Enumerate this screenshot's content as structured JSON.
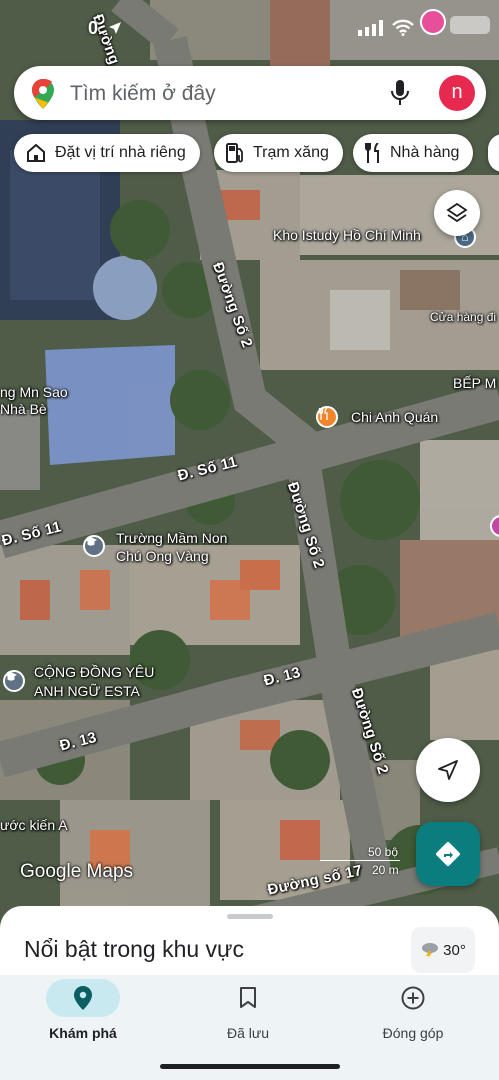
{
  "status_bar": {
    "time": "0"
  },
  "search": {
    "placeholder": "Tìm kiếm ở đây",
    "avatar_letter": "n"
  },
  "chips": [
    {
      "label": "Đặt vị trí nhà riêng",
      "icon": "home-icon"
    },
    {
      "label": "Trạm xăng",
      "icon": "gas-station-icon"
    },
    {
      "label": "Nhà hàng",
      "icon": "restaurant-icon"
    }
  ],
  "map": {
    "roads": {
      "duong_so_2_a": "Đường Số 2",
      "duong_so_2_b": "Đường Số 2",
      "duong_so_2_c": "Đường Số 2",
      "duong_top": "Đường",
      "d_so_11_a": "Đ. Số 11",
      "d_so_11_b": "Đ. Số 11",
      "d_13_a": "Đ. 13",
      "d_13_b": "Đ. 13",
      "duong_so_17": "Đường số 17"
    },
    "pois": {
      "kho_istudy": "Kho Istudy Hồ Chí Minh",
      "cua_hang": "Cửa hàng đi",
      "bep": "BẾP M",
      "mn_sao_1": "ng Mn Sao",
      "mn_sao_2": "Nhà Bè",
      "chi_anh_quan": "Chi Anh Quán",
      "truong_mam_non_1": "Trường Mầm Non",
      "truong_mam_non_2": "Chú Ong Vàng",
      "cong_dong_1": "CỘNG ĐỒNG YÊU",
      "cong_dong_2": "ANH NGỮ ESTA",
      "nuoc_kien": "ước kiến A"
    },
    "scale": {
      "top": "50 bộ",
      "bottom": "20 m"
    },
    "attribution": "Google Maps"
  },
  "sheet": {
    "title": "Nổi bật trong khu vực",
    "temperature": "30°"
  },
  "bottom_nav": [
    {
      "label": "Khám phá",
      "icon": "explore-pin-icon",
      "active": true
    },
    {
      "label": "Đã lưu",
      "icon": "bookmark-icon",
      "active": false
    },
    {
      "label": "Đóng góp",
      "icon": "add-circle-icon",
      "active": false
    }
  ],
  "colors": {
    "accent_teal": "#0b7d7e",
    "nav_active_bg": "#c7e9ef",
    "avatar": "#e8294f",
    "restaurant_poi": "#f2842c"
  }
}
